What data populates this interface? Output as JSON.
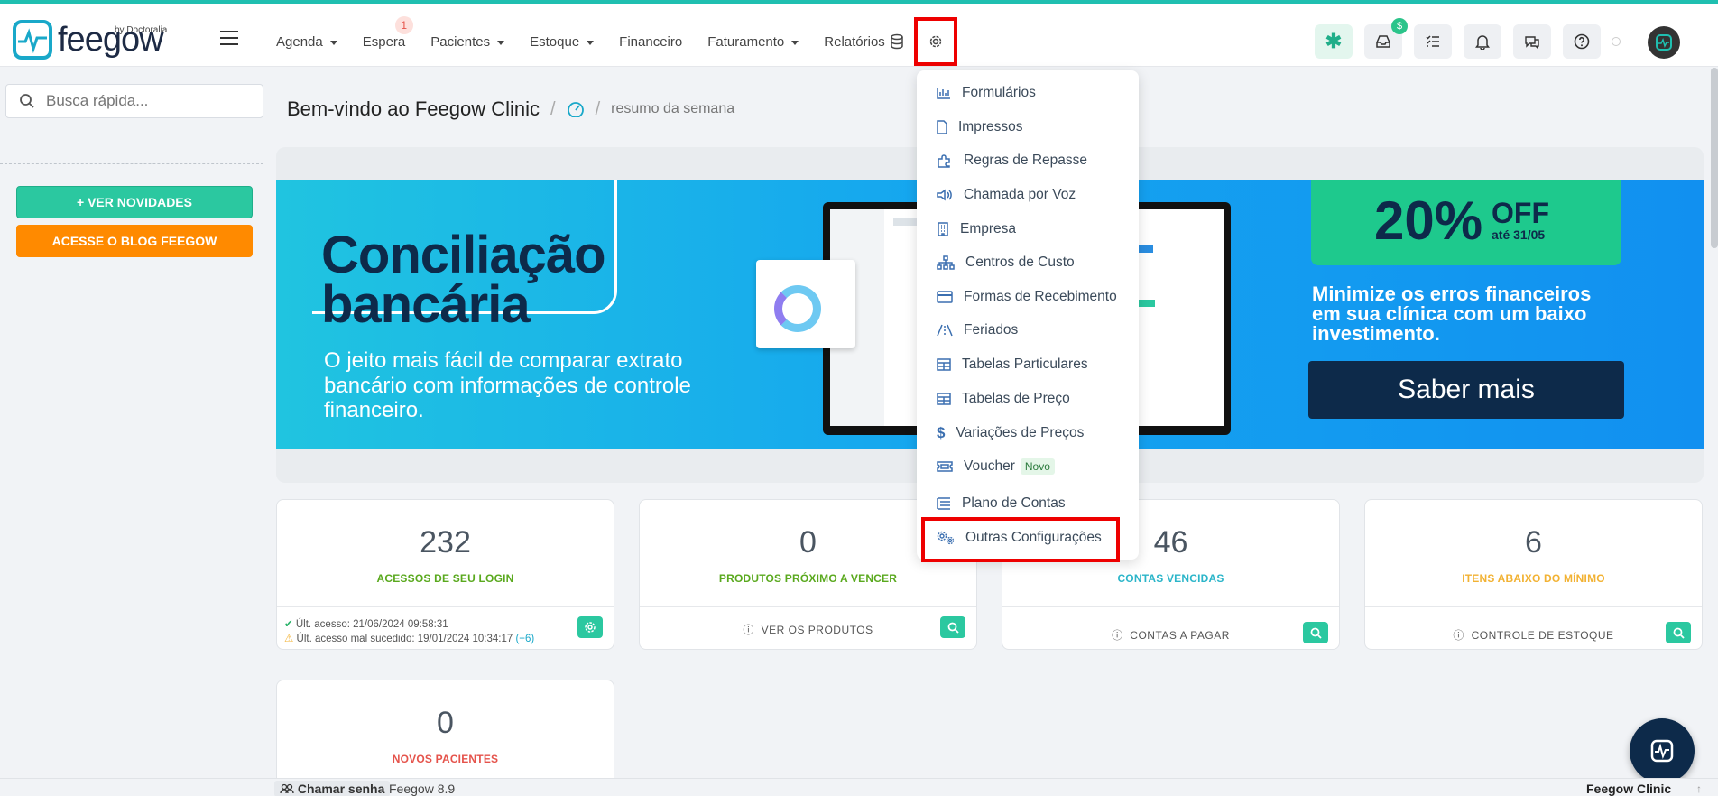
{
  "brand": {
    "name": "feegow",
    "by": "by Doctoralia"
  },
  "nav": {
    "items": [
      {
        "label": "Agenda",
        "caret": true
      },
      {
        "label": "Espera",
        "badge": "1"
      },
      {
        "label": "Pacientes",
        "caret": true
      },
      {
        "label": "Estoque",
        "caret": true
      },
      {
        "label": "Financeiro"
      },
      {
        "label": "Faturamento",
        "caret": true
      },
      {
        "label": "Relatórios"
      }
    ]
  },
  "header_icons": {
    "wallet_badge": "$"
  },
  "sidebar": {
    "search_placeholder": "Busca rápida...",
    "btn_novidades": "+ VER NOVIDADES",
    "btn_blog": "ACESSE O BLOG FEEGOW"
  },
  "breadcrumb": {
    "title": "Bem-vindo ao Feegow Clinic",
    "sub": "resumo da semana"
  },
  "banner": {
    "title_line1": "Conciliação",
    "title_line2": "bancária",
    "subtitle": "O jeito mais fácil de comparar extrato bancário com informações de controle financeiro.",
    "promo_pct": "20%",
    "promo_off": "OFF",
    "promo_until": "até 31/05",
    "promo_text": "Minimize os erros financeiros em sua clínica com um baixo investimento.",
    "cta": "Saber mais"
  },
  "dropdown": {
    "items": [
      {
        "label": "Formulários",
        "icon": "chart-icon"
      },
      {
        "label": "Impressos",
        "icon": "file-icon"
      },
      {
        "label": "Regras de Repasse",
        "icon": "puzzle-icon"
      },
      {
        "label": "Chamada por Voz",
        "icon": "speaker-icon"
      },
      {
        "label": "Empresa",
        "icon": "building-icon"
      },
      {
        "label": "Centros de Custo",
        "icon": "sitemap-icon"
      },
      {
        "label": "Formas de Recebimento",
        "icon": "card-icon"
      },
      {
        "label": "Feriados",
        "icon": "road-icon"
      },
      {
        "label": "Tabelas Particulares",
        "icon": "table-icon"
      },
      {
        "label": "Tabelas de Preço",
        "icon": "table-icon"
      },
      {
        "label": "Variações de Preços",
        "icon": "dollar-icon"
      },
      {
        "label": "Voucher",
        "icon": "ticket-icon",
        "badge": "Novo"
      },
      {
        "label": "Plano de Contas",
        "icon": "list-icon"
      },
      {
        "label": "Outras Configurações",
        "icon": "gears-icon"
      }
    ]
  },
  "stats": [
    {
      "value": "232",
      "label": "ACESSOS DE SEU LOGIN",
      "color": "#5aa91e",
      "line1": "Últ. acesso: 21/06/2024 09:58:31",
      "line2": "Últ. acesso mal sucedido: 19/01/2024 10:34:17",
      "line2_extra": "(+6)"
    },
    {
      "value": "0",
      "label": "PRODUTOS PRÓXIMO A VENCER",
      "color": "#5aa91e",
      "footer": "VER OS PRODUTOS"
    },
    {
      "value": "46",
      "label": "CONTAS VENCIDAS",
      "color": "#2bb5c9",
      "footer": "CONTAS A PAGAR"
    },
    {
      "value": "6",
      "label": "ITENS ABAIXO DO MÍNIMO",
      "color": "#f2b233",
      "footer": "CONTROLE DE ESTOQUE"
    },
    {
      "value": "0",
      "label": "NOVOS PACIENTES",
      "color": "#e5534b"
    }
  ],
  "footer": {
    "chamar": "Chamar senha",
    "version": "Feegow 8.9",
    "right": "Feegow Clinic"
  }
}
